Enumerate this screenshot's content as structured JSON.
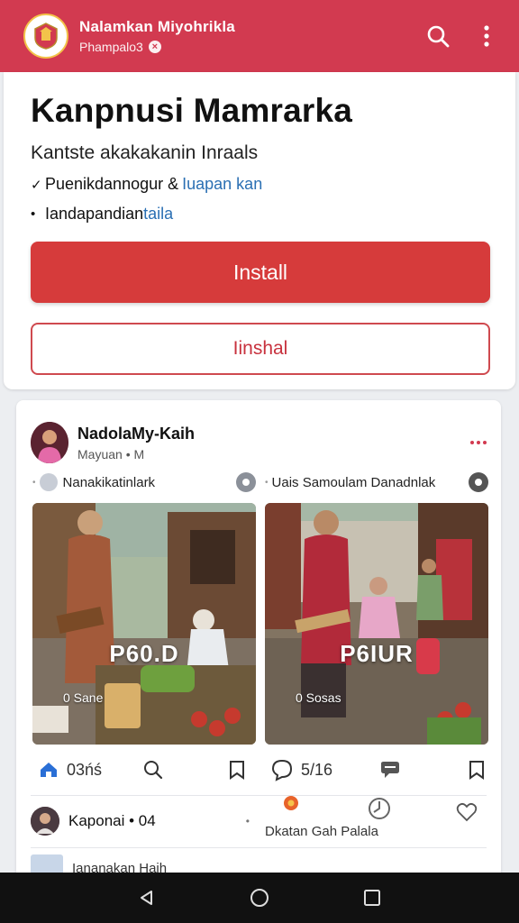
{
  "appbar": {
    "title": "Nalamkan Miyohrikla",
    "subtitle": "Phampalo3",
    "subtitle_badge": "×",
    "icons": [
      "search-icon",
      "more-vert-icon"
    ]
  },
  "install": {
    "title": "Kanpnusi Mamrarka",
    "subtitle": "Kantste akakakanin Inraals",
    "features": [
      {
        "mark": "✓",
        "text": "Puenikdannogur & ",
        "link": "Iuapan kan"
      },
      {
        "mark": "•",
        "text": "Iandapandian",
        "link": "taila"
      }
    ],
    "primary_button": "Install",
    "secondary_button": "Iinshal"
  },
  "post": {
    "author": "NadolaMy-Kaih",
    "meta": "Mayuan • M",
    "left_column": {
      "tag": "Nanakikatinlark",
      "photo_label": "P60.D",
      "photo_count": "0 Sane",
      "action_count": "03ńś"
    },
    "right_column": {
      "tag": "Uais Samoulam Danadnlak",
      "photo_label": "P6IUR",
      "photo_count": "0 Sosas",
      "action_count": "5/16"
    },
    "comment": {
      "name": "Kaponai • 04"
    },
    "footer_text": "Dkatan Gah Palala",
    "peek_text": "Iananakan Haih"
  },
  "colors": {
    "brand": "#d23a50",
    "primary_button": "#d63b3b",
    "link": "#2a6fb3"
  },
  "navbar": {
    "icons": [
      "back-icon",
      "home-icon",
      "recents-icon"
    ]
  }
}
